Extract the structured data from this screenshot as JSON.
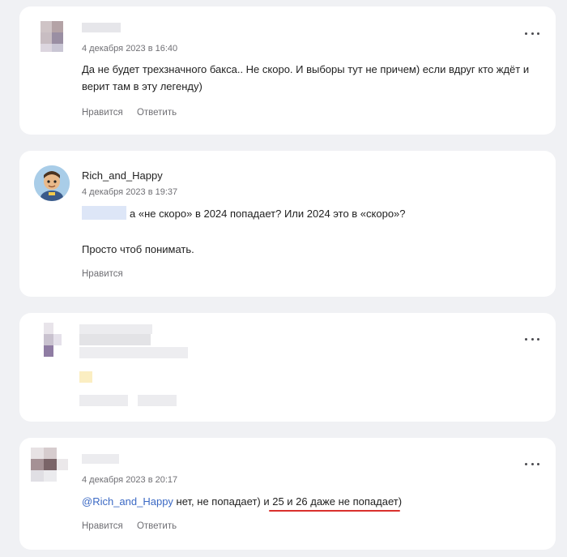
{
  "comments": [
    {
      "date": "4 декабря 2023 в 16:40",
      "text": "Да не будет трехзначного бакса.. Не скоро. И выборы тут не причем) если вдруг кто ждёт и верит там в эту легенду)",
      "like_label": "Нравится",
      "reply_label": "Ответить"
    },
    {
      "username": "Rich_and_Happy",
      "date": "4 декабря 2023 в 19:37",
      "text_line1": "а «не скоро» в 2024 попадает? Или 2024 это в «скоро»?",
      "text_line2": "Просто чтоб понимать.",
      "like_label": "Нравится"
    },
    {
      "hidden": true
    },
    {
      "date": "4 декабря 2023 в 20:17",
      "mention": "@Rich_and_Happy",
      "text_mid": " нет, не попадает) и ",
      "text_underlined": "25 и 26 даже не попадает",
      "text_end": ")",
      "like_label": "Нравится",
      "reply_label": "Ответить"
    }
  ],
  "colors": {
    "background": "#f0f1f4",
    "card": "#ffffff",
    "mention": "#3b69c4",
    "underline": "#d9302c",
    "meta": "#6f6f74"
  },
  "icons": {
    "more": "more-dots-icon"
  }
}
